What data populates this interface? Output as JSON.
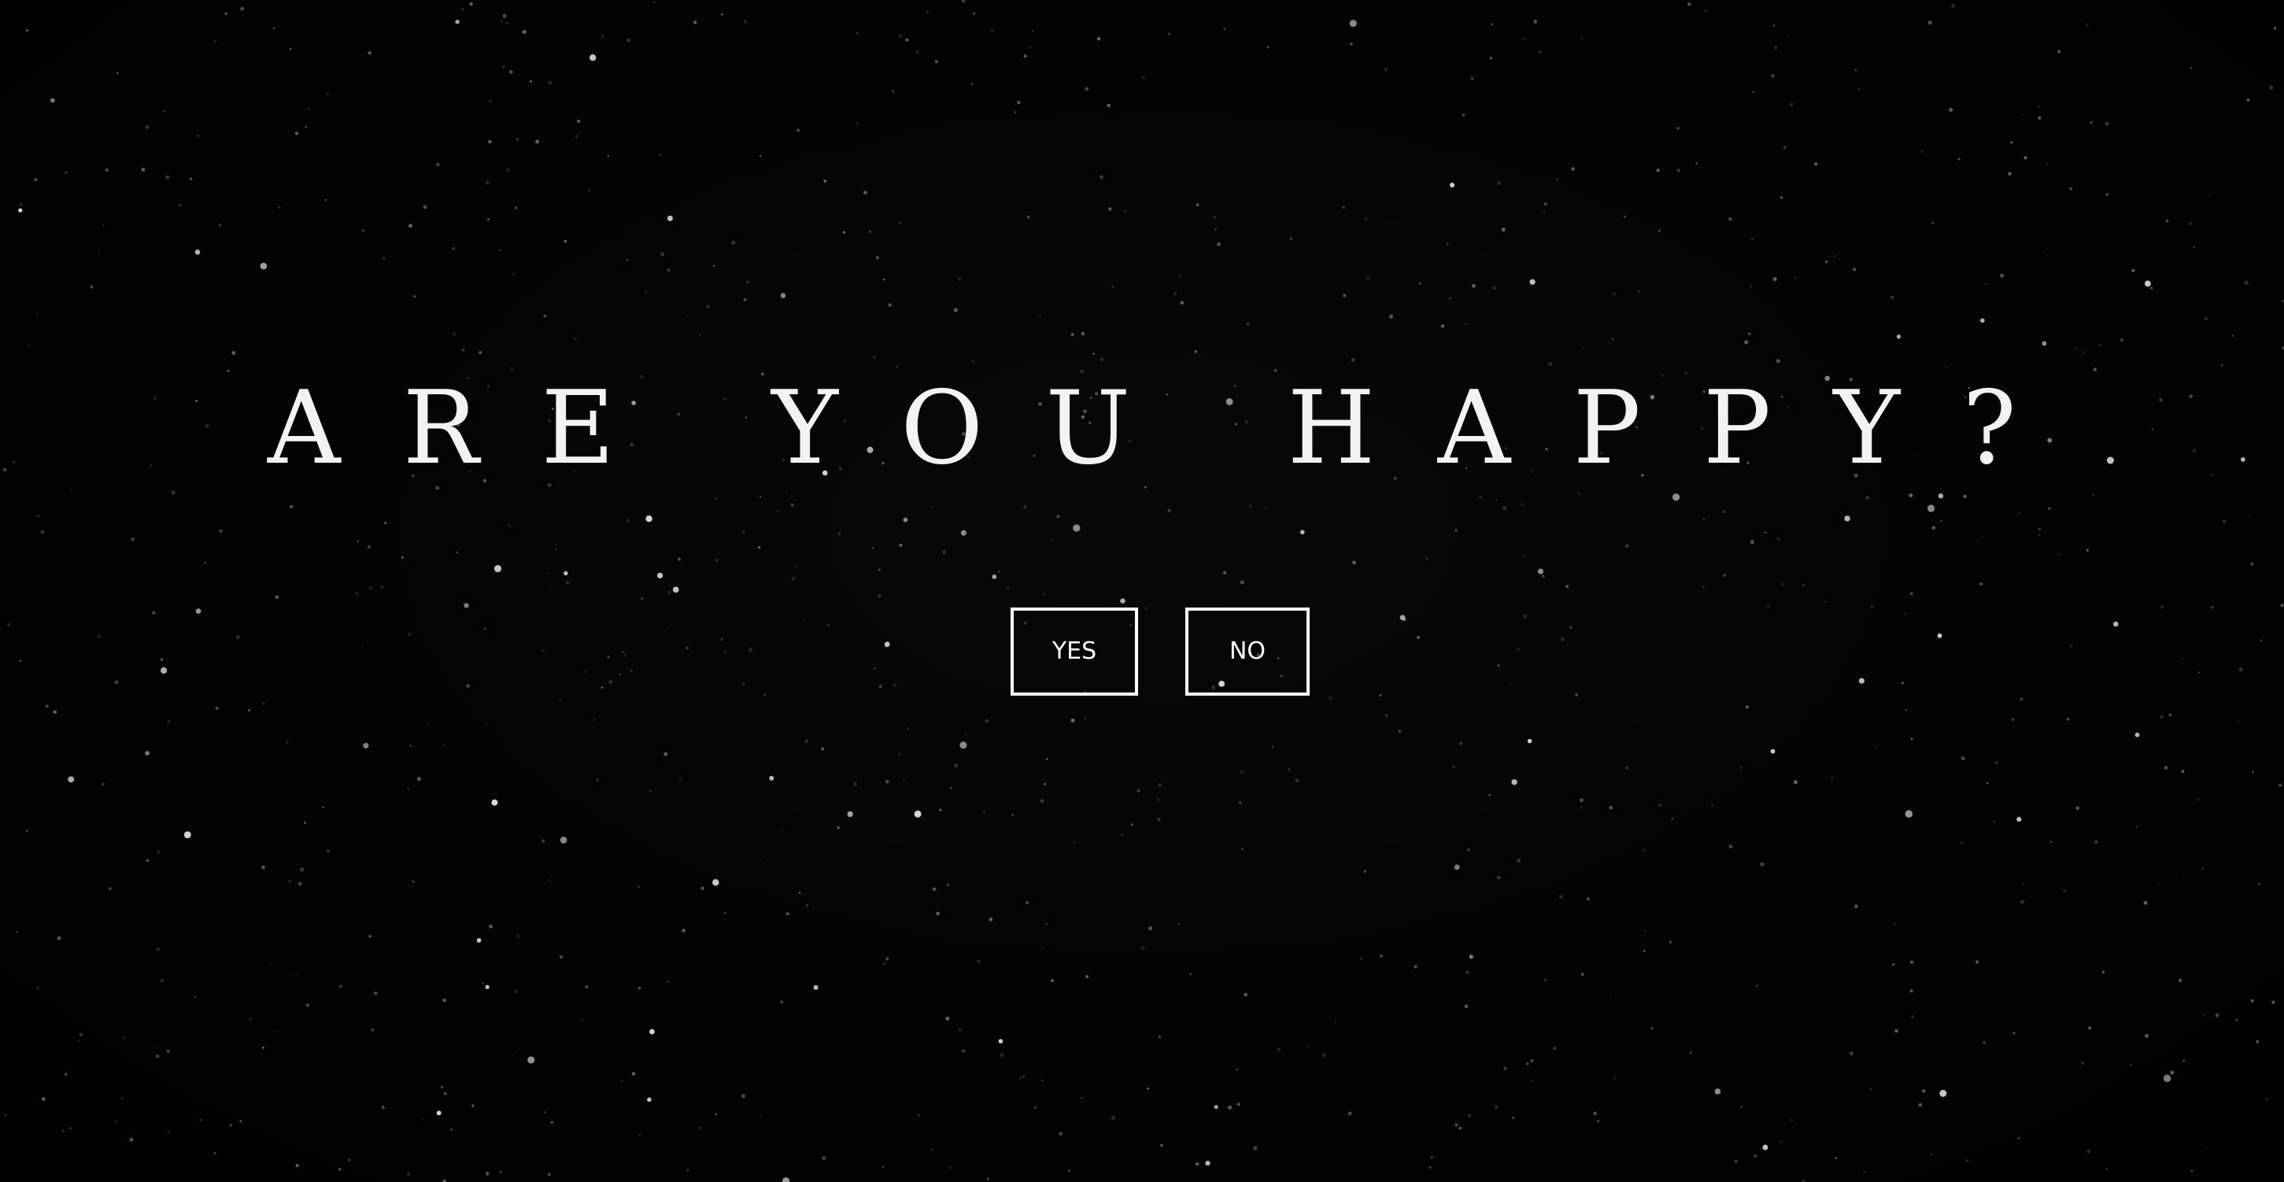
{
  "prompt": {
    "question": "ARE YOU HAPPY?"
  },
  "buttons": {
    "yes_label": "YES",
    "no_label": "NO"
  },
  "colors": {
    "background": "#030303",
    "text": "#f2f2f2",
    "button_border": "#ffffff",
    "stars": "#ffffff"
  }
}
